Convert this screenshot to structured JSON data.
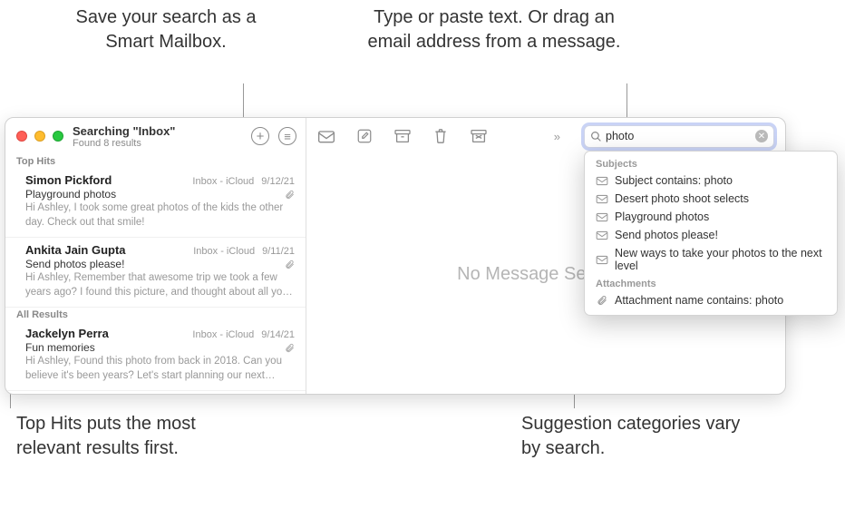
{
  "callouts": {
    "save_smart": "Save your search as a Smart Mailbox.",
    "type_paste": "Type or paste text. Or drag an email address from a message.",
    "top_hits": "Top Hits puts the most relevant results first.",
    "suggestion_cat": "Suggestion categories vary by search."
  },
  "header": {
    "title": "Searching \"Inbox\"",
    "subtitle": "Found 8 results"
  },
  "sections": {
    "top_hits": "Top Hits",
    "all_results": "All Results"
  },
  "messages": [
    {
      "from": "Simon Pickford",
      "mailbox": "Inbox - iCloud",
      "date": "9/12/21",
      "subject": "Playground photos",
      "preview": "Hi Ashley, I took some great photos of the kids the other day. Check out that smile!"
    },
    {
      "from": "Ankita Jain Gupta",
      "mailbox": "Inbox - iCloud",
      "date": "9/11/21",
      "subject": "Send photos please!",
      "preview": "Hi Ashley, Remember that awesome trip we took a few years ago? I found this picture, and thought about all your fun road trip ga…"
    },
    {
      "from": "Jackelyn Perra",
      "mailbox": "Inbox - iCloud",
      "date": "9/14/21",
      "subject": "Fun memories",
      "preview": "Hi Ashley, Found this photo from back in 2018. Can you believe it's been years? Let's start planning our next adventure (or at le…"
    }
  ],
  "search": {
    "value": "photo"
  },
  "no_message": "No Message Selected",
  "suggestions": {
    "subjects_label": "Subjects",
    "subjects": [
      "Subject contains: photo",
      "Desert photo shoot selects",
      "Playground photos",
      "Send photos please!",
      "New ways to take your photos to the next level"
    ],
    "attachments_label": "Attachments",
    "attachments": [
      "Attachment name contains: photo"
    ]
  }
}
